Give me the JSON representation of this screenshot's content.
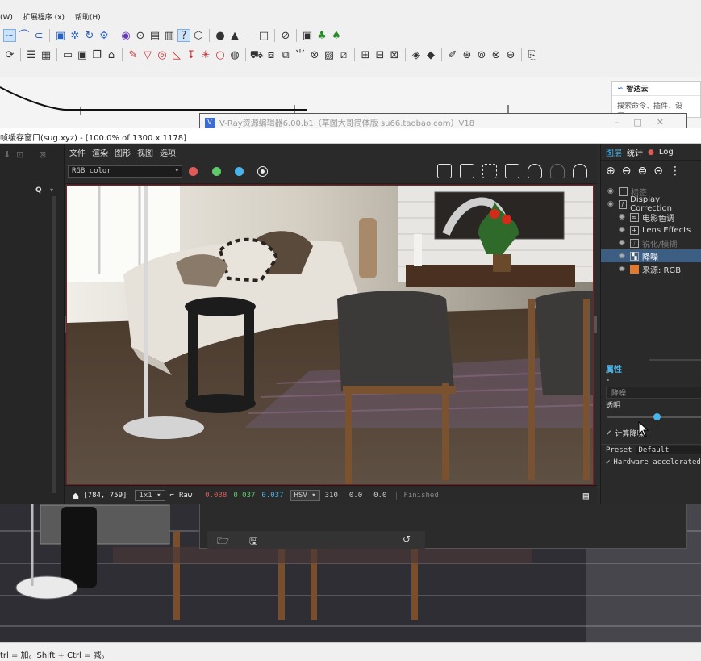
{
  "sketchup": {
    "menus": [
      "(W)",
      "扩展程序 (x)",
      "帮助(H)"
    ],
    "status_text": "trl = 加。Shift + Ctrl = 减。"
  },
  "zhidayun": {
    "title": "智达云",
    "search_placeholder": "搜索命令、插件、设置..."
  },
  "vray_editor": {
    "title": "V-Ray资源编辑器6.00.b1（草图大哥简体版 su66.taobao.com）V18"
  },
  "vfb": {
    "window_title": "帧缓存窗口(sug.xyz) - [100.0% of 1300 x 1178]",
    "menu": [
      "文件",
      "渲染",
      "图形",
      "视图",
      "选项"
    ],
    "channel": "RGB color",
    "search_icon": "Q",
    "status": {
      "coords": "[784, 759]",
      "zoom": "1x1",
      "mode": "Raw",
      "r": "0.038",
      "g": "0.037",
      "b": "0.037",
      "colorspace": "HSV",
      "h": "310",
      "s": "0.0",
      "v": "0.0",
      "state": "Finished"
    }
  },
  "layers_panel": {
    "tabs": [
      "图层",
      "统计",
      "Log"
    ],
    "layers": [
      {
        "label": "标签",
        "dim": true,
        "selected": false
      },
      {
        "label": "Display Correction",
        "dim": false,
        "selected": false
      },
      {
        "label": "电影色调",
        "dim": false,
        "selected": false
      },
      {
        "label": "Lens Effects",
        "dim": false,
        "selected": false
      },
      {
        "label": "锐化/模糊",
        "dim": true,
        "selected": false
      },
      {
        "label": "降噪",
        "dim": false,
        "selected": true
      },
      {
        "label": "来源: RGB",
        "dim": false,
        "selected": false
      }
    ],
    "properties_title": "属性",
    "prop_name": "降噪",
    "opacity_label": "透明",
    "opacity_value": 0.55,
    "compute_denoise": "计算降噪",
    "preset_label": "Preset",
    "preset_value": "Default",
    "hw_accel": "Hardware accelerated"
  },
  "colors": {
    "red_dot": "#e05a5a",
    "green_dot": "#5ecb6a",
    "blue_dot": "#4ab4ea",
    "selection": "#3d5e83"
  }
}
